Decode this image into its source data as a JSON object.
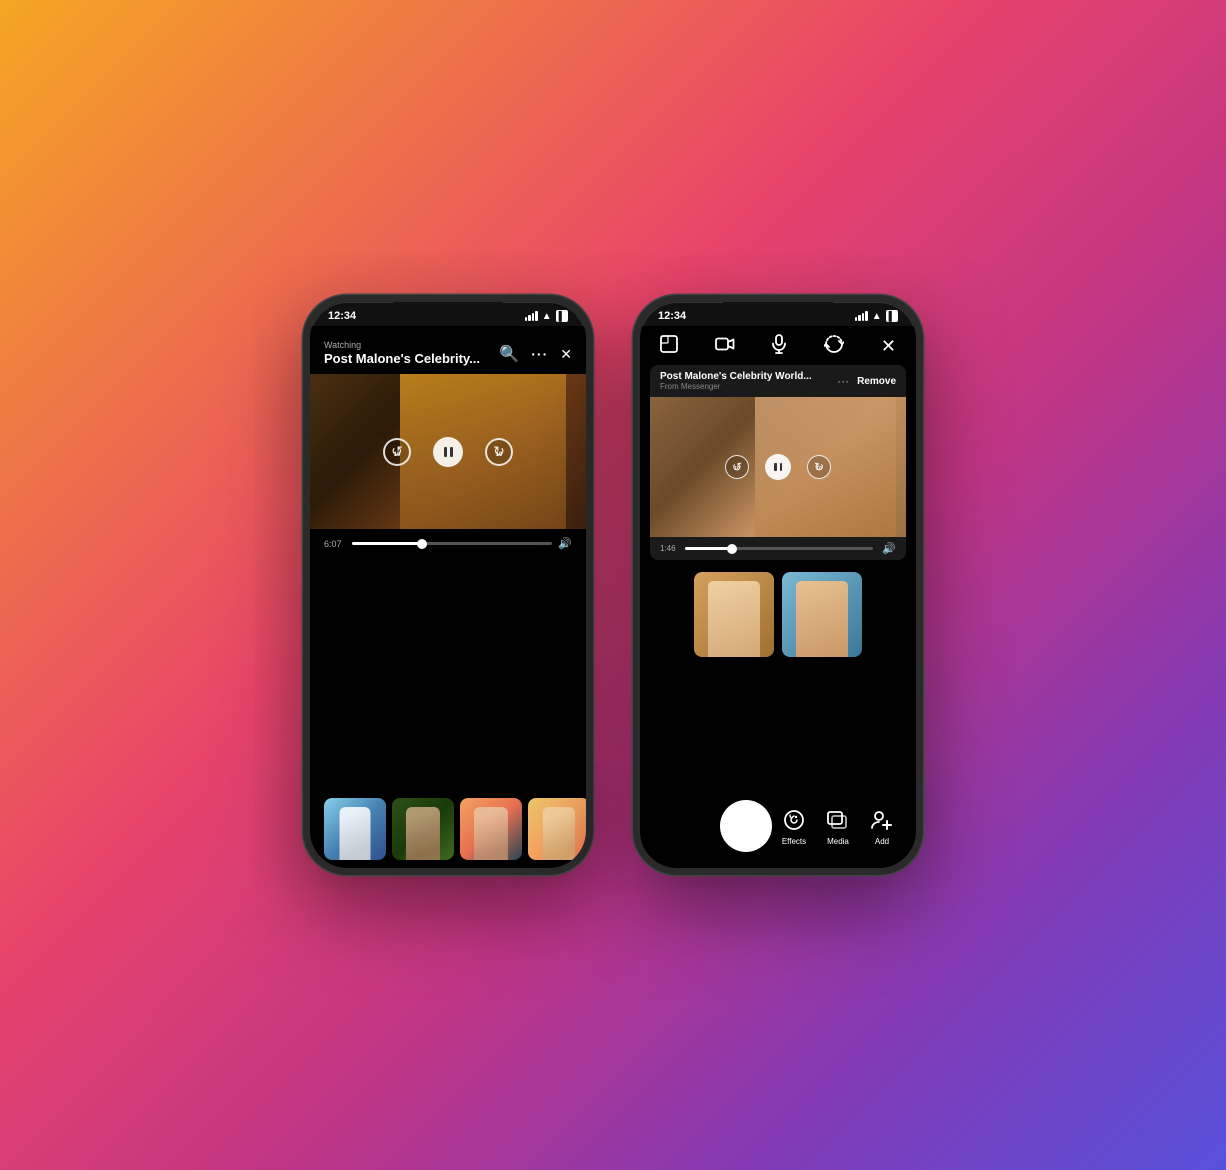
{
  "background": {
    "gradient": "linear-gradient(135deg, #f5a623 0%, #e8446a 40%, #c13584 60%, #833ab4 80%, #5851db 100%)"
  },
  "left_phone": {
    "status": {
      "time": "12:34",
      "signal": true,
      "wifi": true,
      "battery": true
    },
    "watch_label": "Watching",
    "watch_title": "Post Malone's Celebrity...",
    "actions": {
      "search": "🔍",
      "more": "···",
      "close": "✕"
    },
    "video": {
      "time": "6:07",
      "progress_percent": 35
    },
    "participants": [
      {
        "id": 1,
        "label": "participant-1"
      },
      {
        "id": 2,
        "label": "participant-2"
      },
      {
        "id": 3,
        "label": "participant-3"
      },
      {
        "id": 4,
        "label": "participant-4"
      }
    ]
  },
  "right_phone": {
    "status": {
      "time": "12:34",
      "signal": true,
      "wifi": true,
      "battery": true
    },
    "toolbar": {
      "gallery_icon": "gallery",
      "video_icon": "video",
      "mic_icon": "mic",
      "flip_icon": "flip",
      "close_icon": "close"
    },
    "shared_video": {
      "title": "Post Malone's Celebrity World...",
      "source": "From Messenger",
      "more_icon": "···",
      "remove_label": "Remove",
      "time": "1:46",
      "progress_percent": 25
    },
    "participants": [
      {
        "id": 1,
        "label": "right-participant-1"
      },
      {
        "id": 2,
        "label": "right-participant-2"
      }
    ],
    "bottom_controls": {
      "capture_label": "capture",
      "effects_label": "Effects",
      "media_label": "Media",
      "add_label": "Add"
    }
  }
}
